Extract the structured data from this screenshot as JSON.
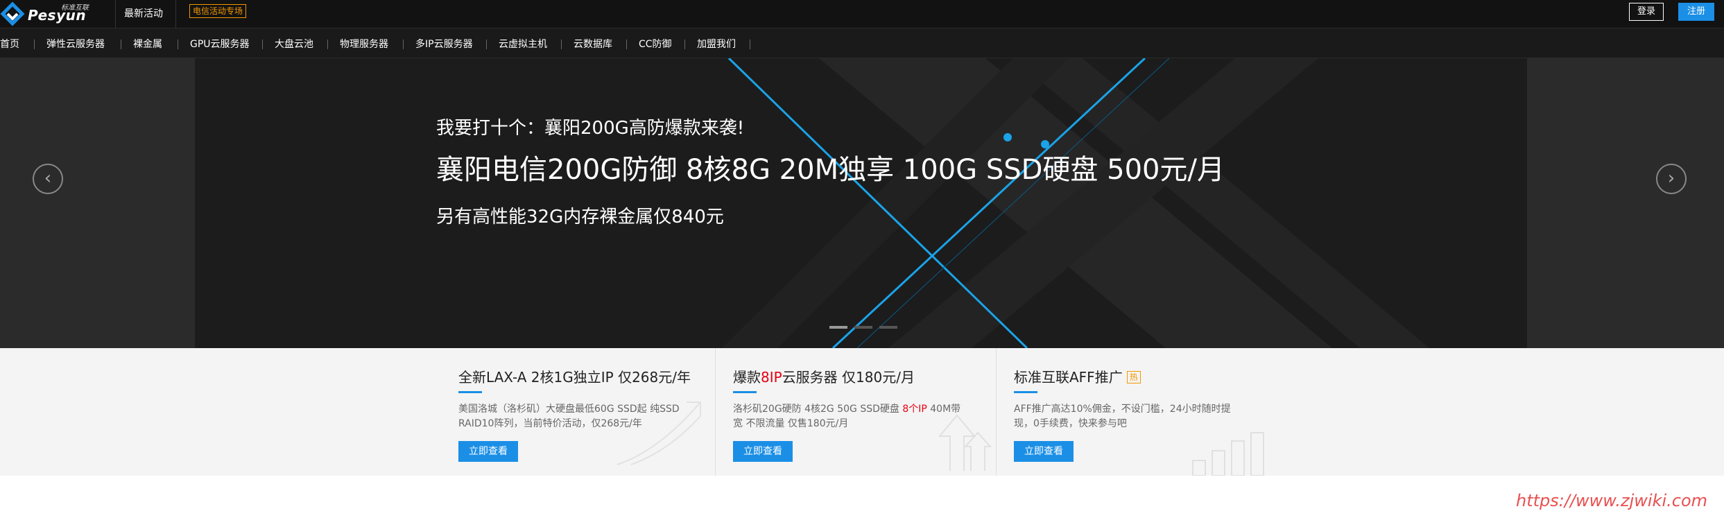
{
  "header": {
    "brand": "Pesyun",
    "slogan": "标准互联",
    "links": [
      "最新活动"
    ],
    "badge": "电信活动专场",
    "login": "登录",
    "register": "注册"
  },
  "nav": {
    "items": [
      "首页",
      "弹性云服务器",
      "裸金属",
      "GPU云服务器",
      "大盘云池",
      "物理服务器",
      "多IP云服务器",
      "云虚拟主机",
      "云数据库",
      "CC防御",
      "加盟我们"
    ]
  },
  "hero": {
    "line1": "我要打十个：襄阳200G高防爆款来袭!",
    "line2": "襄阳电信200G防御 8核8G 20M独享 100G SSD硬盘 500元/月",
    "line3": "另有高性能32G内存裸金属仅840元",
    "prev_icon": "chevron-left-icon",
    "next_icon": "chevron-right-icon",
    "slide_count": 3,
    "active_slide": 1
  },
  "cards": [
    {
      "title": "全新LAX-A 2核1G独立IP 仅268元/年",
      "desc": "美国洛城（洛杉矶）大硬盘最低60G SSD起 纯SSD RAID10阵列，当前特价活动，仅268元/年",
      "button": "立即查看"
    },
    {
      "title_pre": "爆款",
      "title_red": "8IP",
      "title_post": "云服务器 仅180元/月",
      "desc_pre": "洛杉矶20G硬防 4核2G 50G SSD硬盘 ",
      "desc_red": "8个IP",
      "desc_post": " 40M带宽 不限流量 仅售180元/月",
      "button": "立即查看"
    },
    {
      "title": "标准互联AFF推广",
      "badge": "热",
      "desc": "AFF推广高达10%佣金，不设门槛，24小时随时提现，0手续费，快来参与吧",
      "button": "立即查看"
    }
  ],
  "watermark": "https://www.zjwiki.com",
  "colors": {
    "accent": "#1b8fe6",
    "badge_orange": "#f39800",
    "red": "#e60012",
    "topbar": "#121212"
  }
}
